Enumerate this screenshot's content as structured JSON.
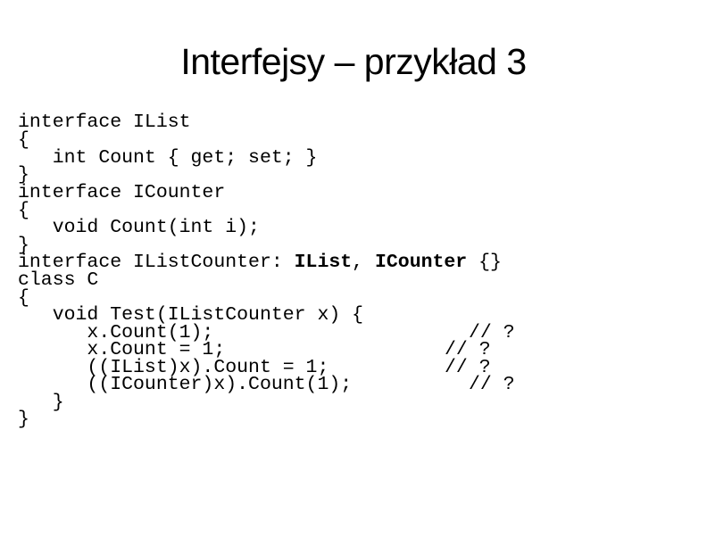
{
  "slide": {
    "title": "Interfejsy – przykład 3",
    "code": {
      "l1": "interface IList",
      "l2": "{",
      "l3": "   int Count { get; set; }",
      "l4": "}",
      "l5": "interface ICounter",
      "l6": "{",
      "l7": "   void Count(int i);",
      "l8": "}",
      "l9a": "interface IListCounter: ",
      "l9b": "IList",
      "l9c": ", ",
      "l9d": "ICounter",
      "l9e": " {}",
      "l10": "class C",
      "l11": "{",
      "l12": "   void Test(IListCounter x) {",
      "l13": "      x.Count(1);",
      "l14": "      x.Count = 1;",
      "l15": "      ((IList)x).Count = 1;",
      "l16": "      ((ICounter)x).Count(1);",
      "l17": "   }",
      "l18": "}",
      "c13": "// ?",
      "c14": "// ?",
      "c15": "// ?",
      "c16": "// ?"
    }
  }
}
